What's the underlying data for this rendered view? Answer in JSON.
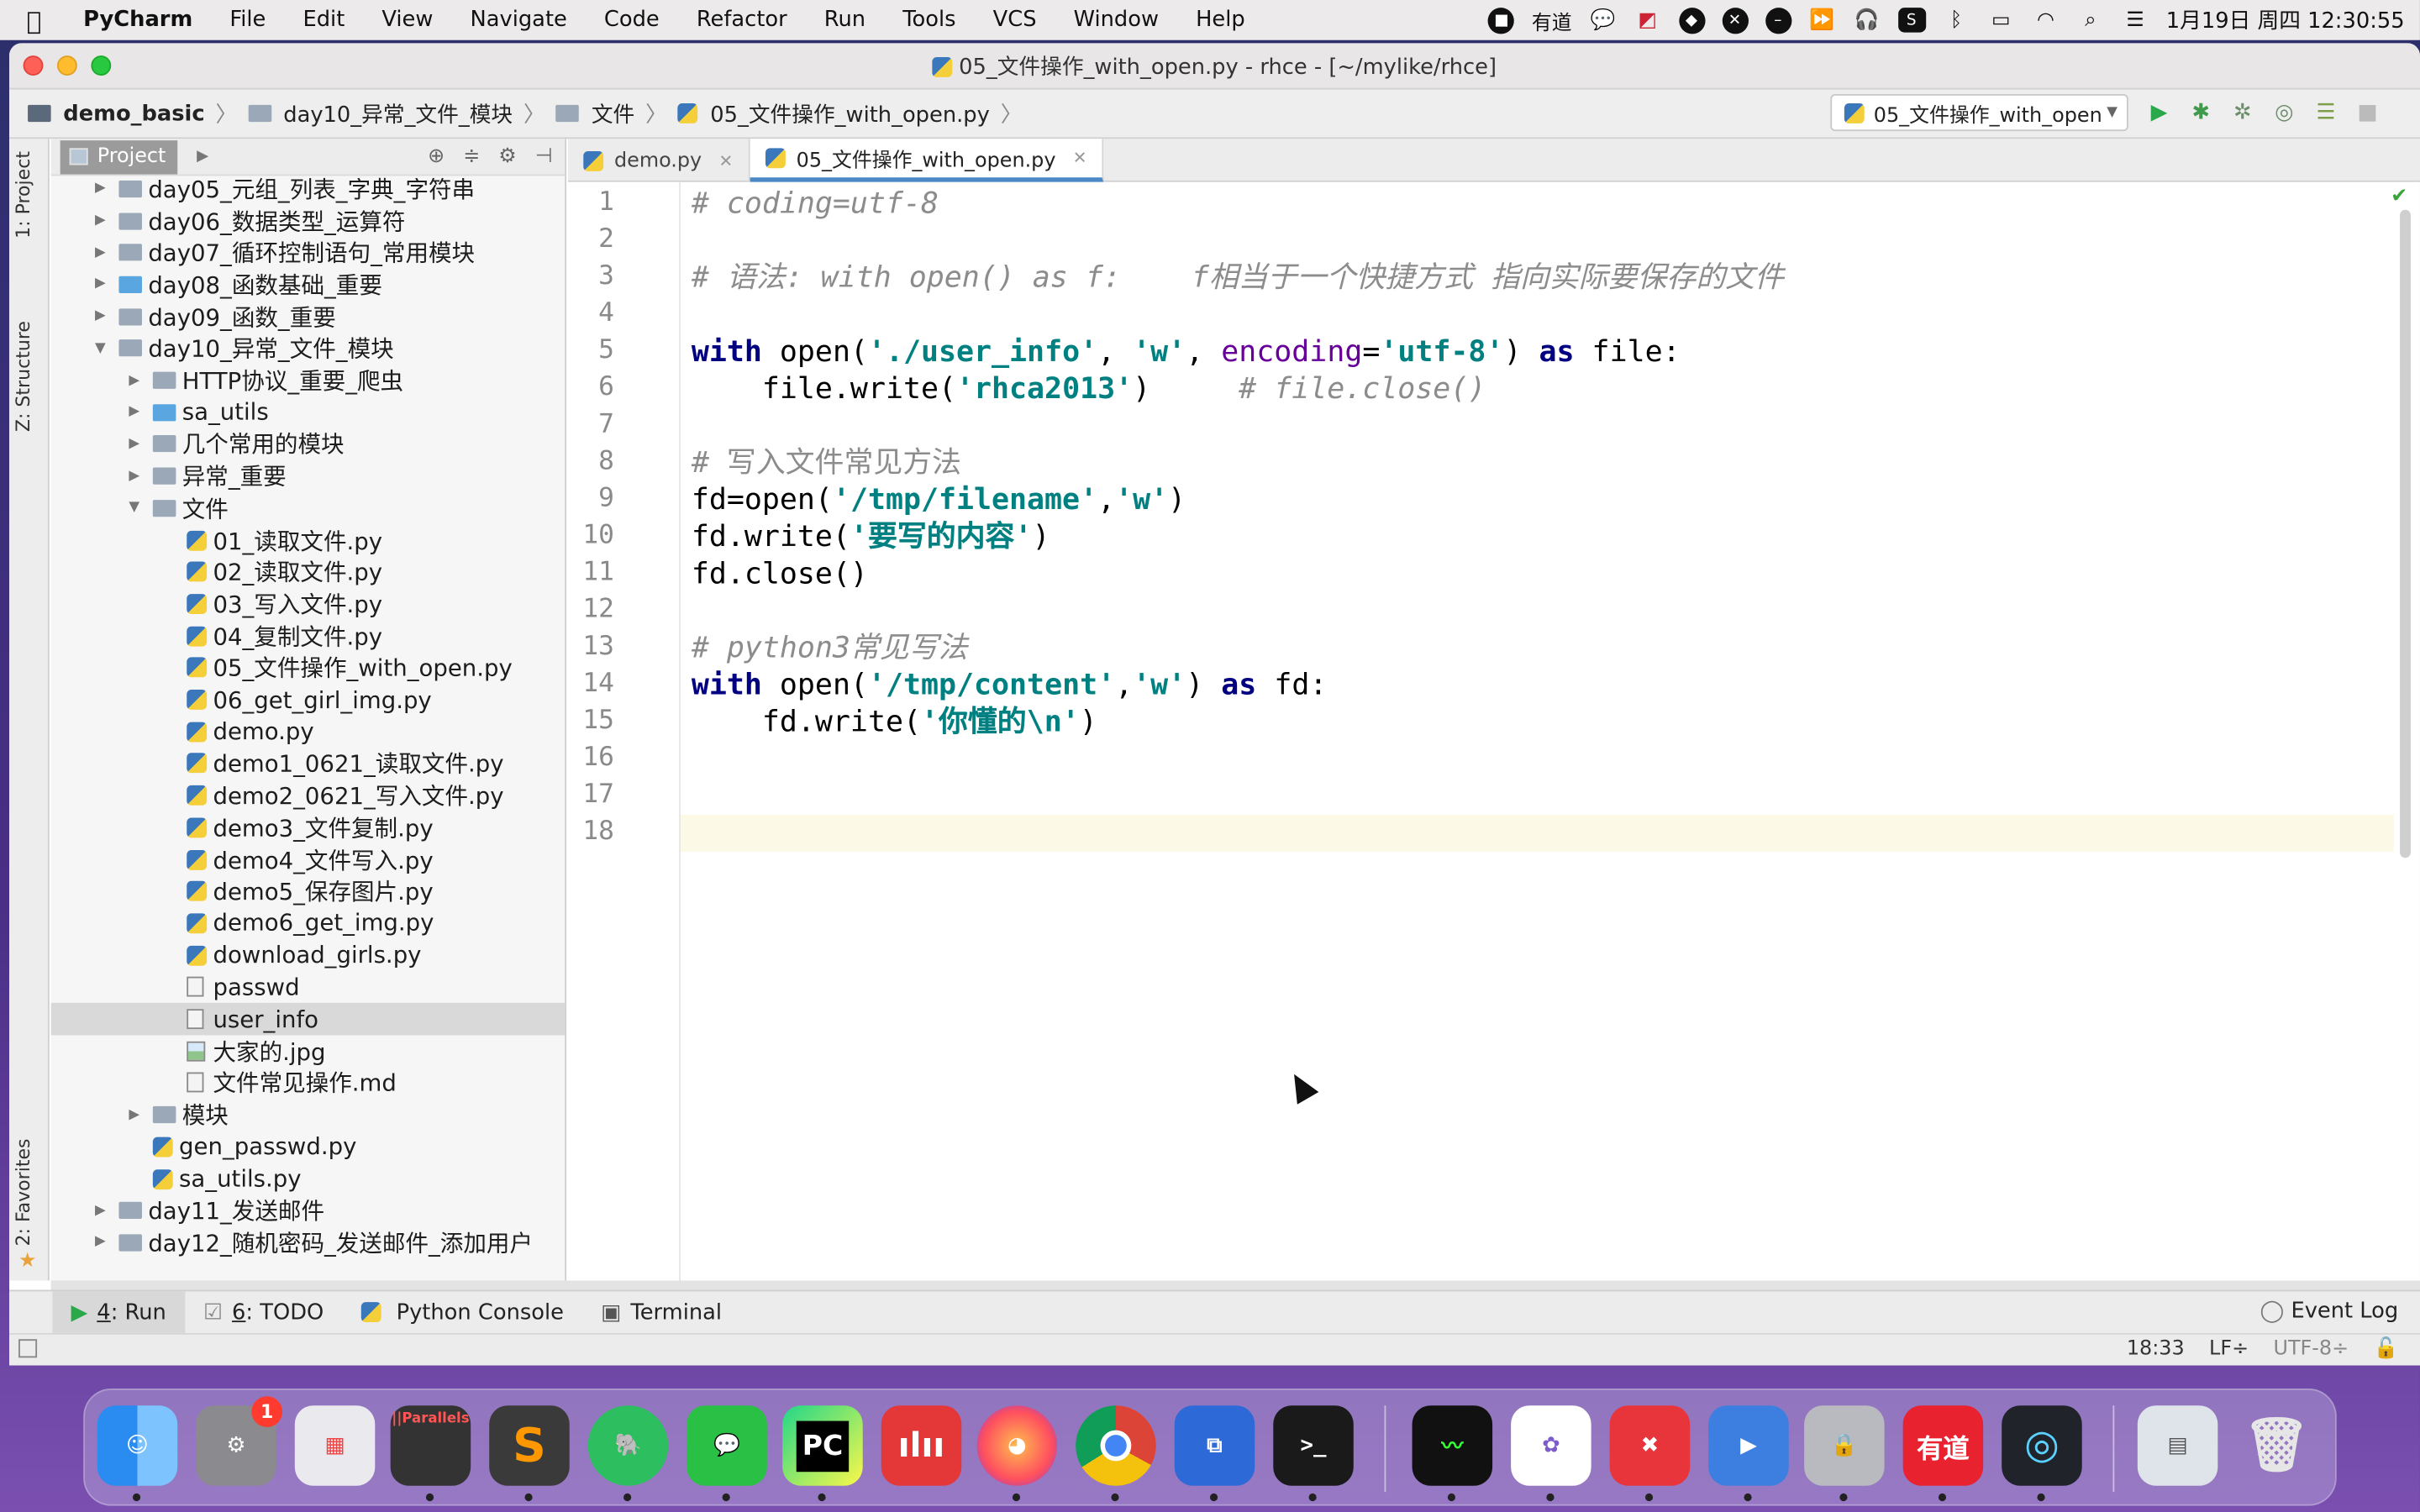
{
  "menubar": {
    "app_name": "PyCharm",
    "items": [
      "File",
      "Edit",
      "View",
      "Navigate",
      "Code",
      "Refactor",
      "Run",
      "Tools",
      "VCS",
      "Window",
      "Help"
    ],
    "youdao": "有道",
    "datetime": "1月19日 周四 12:30:55"
  },
  "window": {
    "title": "05_文件操作_with_open.py - rhce - [~/mylike/rhce]"
  },
  "navbar": {
    "crumbs": [
      "demo_basic",
      "day10_异常_文件_模块",
      "文件",
      "05_文件操作_with_open.py"
    ],
    "run_config": "05_文件操作_with_open"
  },
  "side_tabs": {
    "project": "1: Project",
    "structure": "Z: Structure",
    "favorites": "2: Favorites"
  },
  "project_panel": {
    "tab_label": "Project",
    "tree": [
      {
        "label": "day05_元组_列表_字典_字符串",
        "depth": 0,
        "type": "folder",
        "toggle": "▶"
      },
      {
        "label": "day06_数据类型_运算符",
        "depth": 0,
        "type": "folder",
        "toggle": "▶"
      },
      {
        "label": "day07_循环控制语句_常用模块",
        "depth": 0,
        "type": "folder",
        "toggle": "▶"
      },
      {
        "label": "day08_函数基础_重要",
        "depth": 0,
        "type": "folder-blue",
        "toggle": "▶"
      },
      {
        "label": "day09_函数_重要",
        "depth": 0,
        "type": "folder",
        "toggle": "▶"
      },
      {
        "label": "day10_异常_文件_模块",
        "depth": 0,
        "type": "folder",
        "toggle": "▼"
      },
      {
        "label": "HTTP协议_重要_爬虫",
        "depth": 1,
        "type": "folder",
        "toggle": "▶"
      },
      {
        "label": "sa_utils",
        "depth": 1,
        "type": "folder-blue",
        "toggle": "▶"
      },
      {
        "label": "几个常用的模块",
        "depth": 1,
        "type": "folder",
        "toggle": "▶"
      },
      {
        "label": "异常_重要",
        "depth": 1,
        "type": "folder",
        "toggle": "▶"
      },
      {
        "label": "文件",
        "depth": 1,
        "type": "folder",
        "toggle": "▼"
      },
      {
        "label": "01_读取文件.py",
        "depth": 2,
        "type": "py",
        "toggle": ""
      },
      {
        "label": "02_读取文件.py",
        "depth": 2,
        "type": "py",
        "toggle": ""
      },
      {
        "label": "03_写入文件.py",
        "depth": 2,
        "type": "py",
        "toggle": ""
      },
      {
        "label": "04_复制文件.py",
        "depth": 2,
        "type": "py",
        "toggle": ""
      },
      {
        "label": "05_文件操作_with_open.py",
        "depth": 2,
        "type": "py",
        "toggle": ""
      },
      {
        "label": "06_get_girl_img.py",
        "depth": 2,
        "type": "py",
        "toggle": ""
      },
      {
        "label": "demo.py",
        "depth": 2,
        "type": "py",
        "toggle": ""
      },
      {
        "label": "demo1_0621_读取文件.py",
        "depth": 2,
        "type": "py",
        "toggle": ""
      },
      {
        "label": "demo2_0621_写入文件.py",
        "depth": 2,
        "type": "py",
        "toggle": ""
      },
      {
        "label": "demo3_文件复制.py",
        "depth": 2,
        "type": "py",
        "toggle": ""
      },
      {
        "label": "demo4_文件写入.py",
        "depth": 2,
        "type": "py",
        "toggle": ""
      },
      {
        "label": "demo5_保存图片.py",
        "depth": 2,
        "type": "py",
        "toggle": ""
      },
      {
        "label": "demo6_get_img.py",
        "depth": 2,
        "type": "py",
        "toggle": ""
      },
      {
        "label": "download_girls.py",
        "depth": 2,
        "type": "py",
        "toggle": ""
      },
      {
        "label": "passwd",
        "depth": 2,
        "type": "txt",
        "toggle": ""
      },
      {
        "label": "user_info",
        "depth": 2,
        "type": "txt",
        "toggle": "",
        "selected": true
      },
      {
        "label": "大家的.jpg",
        "depth": 2,
        "type": "img",
        "toggle": ""
      },
      {
        "label": "文件常见操作.md",
        "depth": 2,
        "type": "txt",
        "toggle": ""
      },
      {
        "label": "模块",
        "depth": 1,
        "type": "folder",
        "toggle": "▶"
      },
      {
        "label": "gen_passwd.py",
        "depth": 1,
        "type": "py",
        "toggle": ""
      },
      {
        "label": "sa_utils.py",
        "depth": 1,
        "type": "py",
        "toggle": ""
      },
      {
        "label": "day11_发送邮件",
        "depth": 0,
        "type": "folder",
        "toggle": "▶"
      },
      {
        "label": "day12_随机密码_发送邮件_添加用户",
        "depth": 0,
        "type": "folder",
        "toggle": "▶"
      }
    ]
  },
  "editor": {
    "tabs": [
      {
        "label": "demo.py",
        "active": false
      },
      {
        "label": "05_文件操作_with_open.py",
        "active": true
      }
    ],
    "line_numbers": [
      "1",
      "2",
      "3",
      "4",
      "5",
      "6",
      "7",
      "8",
      "9",
      "10",
      "11",
      "12",
      "13",
      "14",
      "15",
      "16",
      "17",
      "18"
    ],
    "code": {
      "l1": "# coding=utf-8",
      "l3": "# 语法: with open() as f:    f相当于一个快捷方式 指向实际要保存的文件",
      "l5_kw": "with",
      "l5_fn": " open(",
      "l5_s1": "'./user_info'",
      "l5_c1": ", ",
      "l5_s2": "'w'",
      "l5_c2": ", ",
      "l5_prm": "encoding",
      "l5_eq": "=",
      "l5_s3": "'utf-8'",
      "l5_close": ") ",
      "l5_as": "as",
      "l5_var": " file:",
      "l6_pre": "    file.write(",
      "l6_s": "'rhca2013'",
      "l6_post": ")     ",
      "l6_cm": "# file.close()",
      "l8": "# 写入文件常见方法",
      "l9_pre": "fd=open(",
      "l9_s1": "'/tmp/filename'",
      "l9_c": ",",
      "l9_s2": "'w'",
      "l9_post": ")",
      "l10_pre": "fd.write(",
      "l10_s": "'要写的内容'",
      "l10_post": ")",
      "l11": "fd.close()",
      "l13": "# python3常见写法",
      "l14_kw": "with",
      "l14_fn": " open(",
      "l14_s1": "'/tmp/content'",
      "l14_c": ",",
      "l14_s2": "'w'",
      "l14_close": ") ",
      "l14_as": "as",
      "l14_var": " fd:",
      "l15_pre": "    fd.write(",
      "l15_s": "'你懂的\\n'",
      "l15_post": ")"
    }
  },
  "bottom_tabs": {
    "run_num": "4",
    "run": ": Run",
    "todo_num": "6",
    "todo": ": TODO",
    "console": "Python Console",
    "terminal": "Terminal",
    "event_log": "Event Log"
  },
  "statusbar": {
    "position": "18:33",
    "line_sep": "LF÷",
    "encoding": "UTF-8÷"
  },
  "dock": {
    "settings_badge": "1",
    "parallels": "||Parallels",
    "pycharm": "PC",
    "youdao": "有道"
  }
}
